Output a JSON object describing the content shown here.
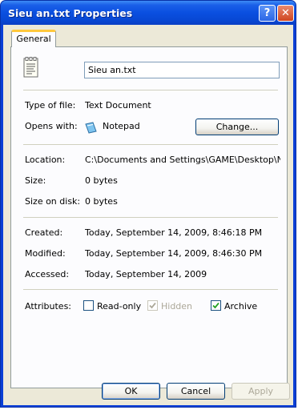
{
  "window": {
    "title": "Sieu an.txt Properties",
    "help_label": "?",
    "close_label": "✕"
  },
  "tabs": [
    {
      "label": "General"
    }
  ],
  "general": {
    "file_name": "Sieu an.txt",
    "type_label": "Type of file:",
    "type_value": "Text Document",
    "opens_label": "Opens with:",
    "opens_value": "Notepad",
    "change_label": "Change...",
    "location_label": "Location:",
    "location_value": "C:\\Documents and Settings\\GAME\\Desktop\\New F",
    "size_label": "Size:",
    "size_value": "0 bytes",
    "size_disk_label": "Size on disk:",
    "size_disk_value": "0 bytes",
    "created_label": "Created:",
    "created_value": "Today, September 14, 2009, 8:46:18 PM",
    "modified_label": "Modified:",
    "modified_value": "Today, September 14, 2009, 8:46:30 PM",
    "accessed_label": "Accessed:",
    "accessed_value": "Today, September 14, 2009",
    "attributes_label": "Attributes:",
    "readonly_label": "Read-only",
    "readonly_checked": false,
    "hidden_label": "Hidden",
    "hidden_checked": true,
    "archive_label": "Archive",
    "archive_checked": true
  },
  "buttons": {
    "ok": "OK",
    "cancel": "Cancel",
    "apply": "Apply"
  },
  "colors": {
    "titlebar": "#0a4fe0",
    "dialog_bg": "#ece9d8",
    "tab_highlight": "#ffc83c",
    "check_mark": "#21a121"
  },
  "icons": {
    "file": "text-document-icon",
    "opens_with": "notepad-icon",
    "help": "help-icon",
    "close": "close-icon"
  }
}
